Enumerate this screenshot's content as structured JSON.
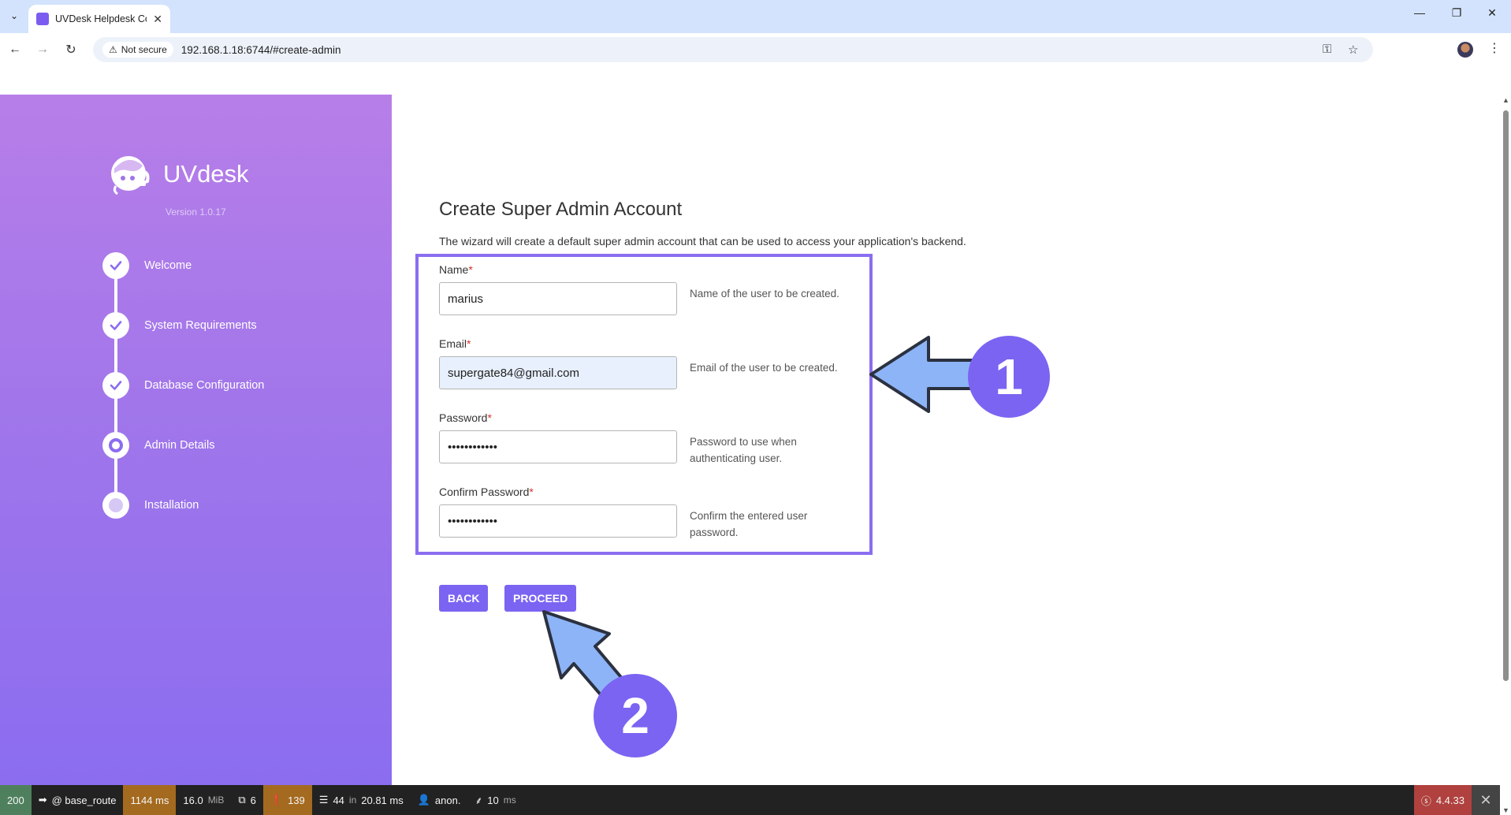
{
  "browser": {
    "tab_title": "UVDesk Helpdesk Co",
    "not_secure": "Not secure",
    "url": "192.168.1.18:6744/#create-admin"
  },
  "sidebar": {
    "brand": "UVdesk",
    "version": "Version 1.0.17",
    "steps": [
      {
        "label": "Welcome",
        "state": "done"
      },
      {
        "label": "System Requirements",
        "state": "done"
      },
      {
        "label": "Database Configuration",
        "state": "done"
      },
      {
        "label": "Admin Details",
        "state": "active"
      },
      {
        "label": "Installation",
        "state": "pending"
      }
    ]
  },
  "main": {
    "heading": "Create Super Admin Account",
    "intro": "The wizard will create a default super admin account that can be used to access your application's backend.",
    "required_mark": "*",
    "fields": {
      "name": {
        "label": "Name",
        "value": "marius",
        "help": "Name of the user to be created."
      },
      "email": {
        "label": "Email",
        "value": "supergate84@gmail.com",
        "help": "Email of the user to be created."
      },
      "password": {
        "label": "Password",
        "value": "••••••••••••",
        "help": "Password to use when authenticating user."
      },
      "confirm": {
        "label": "Confirm Password",
        "value": "••••••••••••",
        "help": "Confirm the entered user password."
      }
    },
    "back_label": "BACK",
    "proceed_label": "PROCEED"
  },
  "annotations": {
    "badge_1": "1",
    "badge_2": "2"
  },
  "debug_toolbar": {
    "status": "200",
    "route": "@ base_route",
    "time": "1144 ms",
    "memory": "16.0",
    "memory_unit": "MiB",
    "forms": "6",
    "logs": "139",
    "db_queries": "44",
    "db_in": "in",
    "db_time": "20.81 ms",
    "user": "anon.",
    "twig_time": "10",
    "twig_unit": "ms",
    "symfony_version": "4.4.33"
  },
  "colors": {
    "accent": "#7b64f2",
    "sidebar_top": "#b77ee8",
    "sidebar_bottom": "#8b6df0",
    "annotation_arrow": "#8db4f7"
  }
}
